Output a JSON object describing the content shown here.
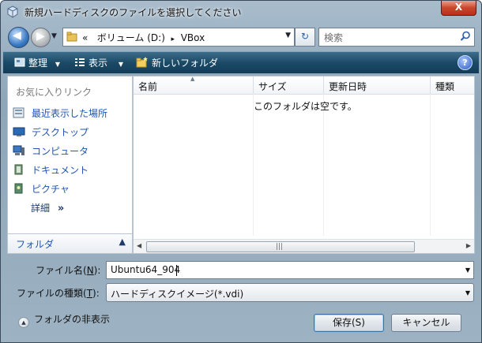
{
  "window": {
    "title": "新規ハードディスクのファイルを選択してください",
    "close_label": "X"
  },
  "address": {
    "prefix": "«",
    "path": [
      "ボリューム (D:)",
      "VBox"
    ],
    "separator": "▸"
  },
  "search": {
    "placeholder": "検索"
  },
  "toolbar": {
    "organize_label": "整理",
    "views_label": "表示",
    "new_folder_label": "新しいフォルダ",
    "help_label": "?"
  },
  "sidebar": {
    "header": "お気に入りリンク",
    "items": [
      {
        "label": "最近表示した場所",
        "icon": "recent-places-icon"
      },
      {
        "label": "デスクトップ",
        "icon": "desktop-icon"
      },
      {
        "label": "コンピュータ",
        "icon": "computer-icon"
      },
      {
        "label": "ドキュメント",
        "icon": "documents-icon"
      },
      {
        "label": "ピクチャ",
        "icon": "pictures-icon"
      }
    ],
    "more_label": "詳細",
    "more_chevron": "»",
    "folders_label": "フォルダ",
    "folders_toggle": "▲"
  },
  "file_list": {
    "columns": [
      "名前",
      "サイズ",
      "更新日時",
      "種類"
    ],
    "empty_message": "このフォルダは空です。"
  },
  "form": {
    "filename_label": "ファイル名(",
    "filename_accel": "N",
    "filename_label_end": "):",
    "filename_value": "Ubuntu64_904",
    "filetype_label": "ファイルの種類(",
    "filetype_accel": "T",
    "filetype_label_end": "):",
    "filetype_value": "ハードディスクイメージ(*.vdi)"
  },
  "footer": {
    "hide_folders_label": "フォルダの非表示",
    "save_label": "保存(S)",
    "cancel_label": "キャンセル"
  },
  "colors": {
    "link_blue": "#1f54b4",
    "toolbar_dark": "#1b4a66",
    "close_red": "#c9462c"
  }
}
